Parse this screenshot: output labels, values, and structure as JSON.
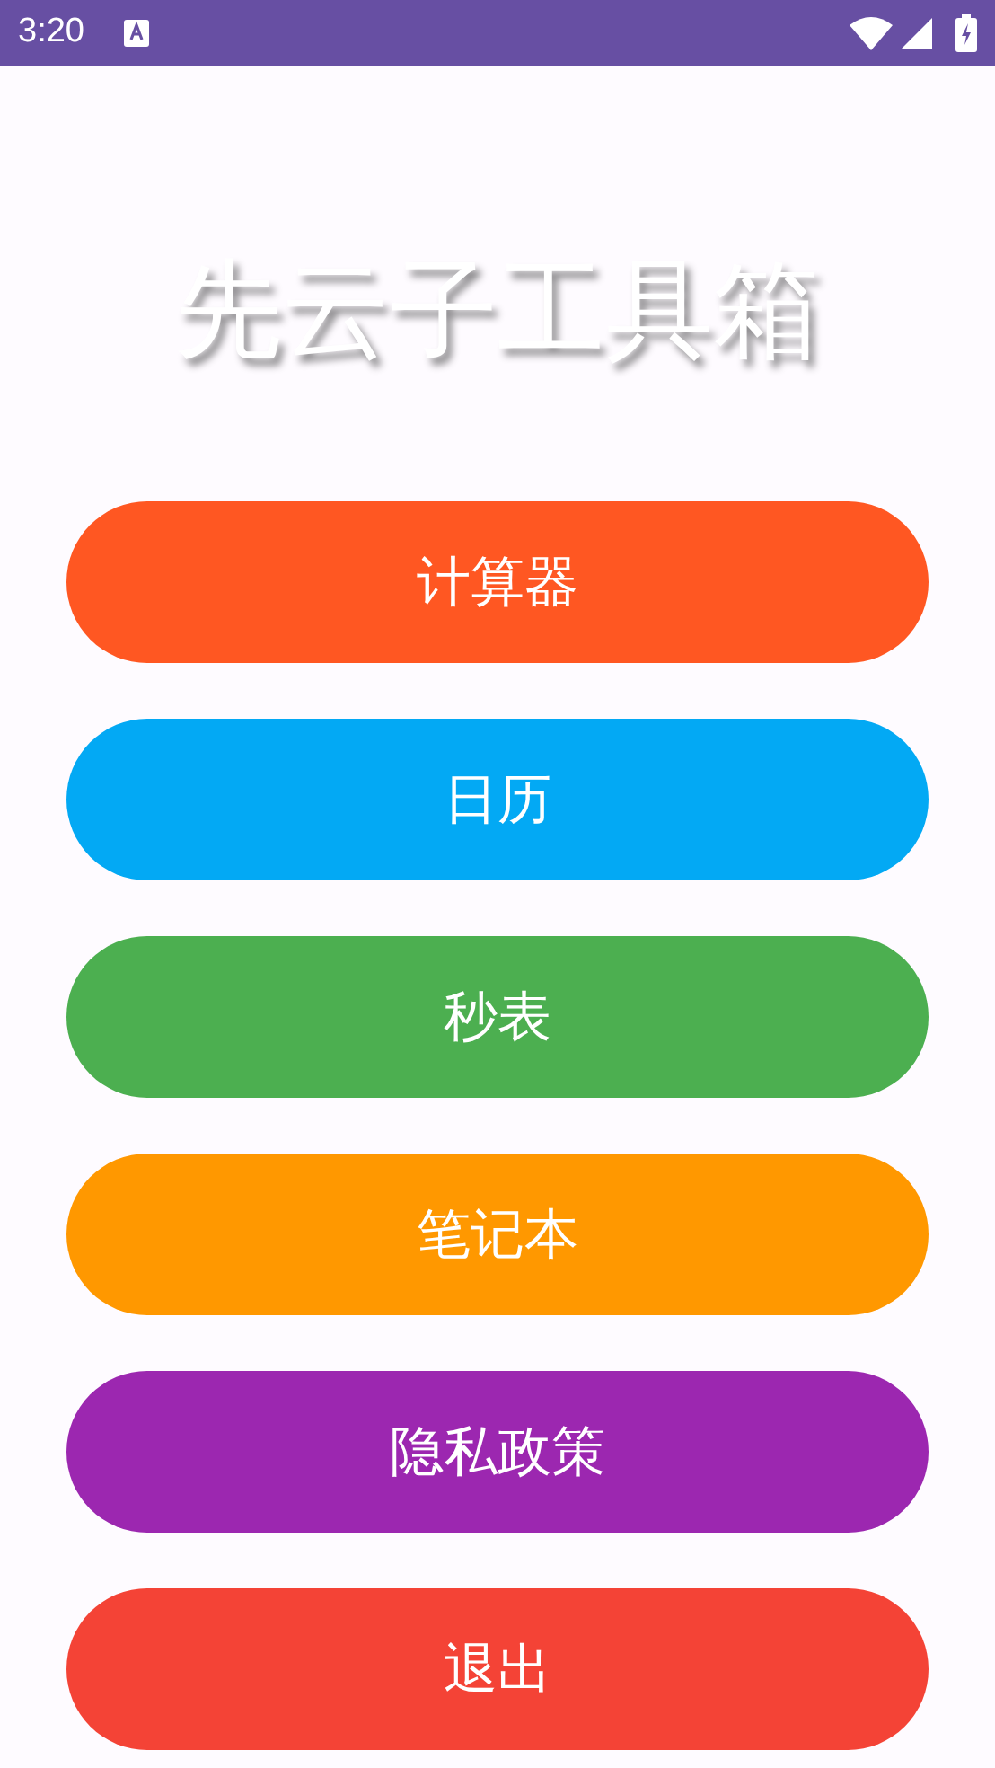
{
  "status_bar": {
    "time": "3:20"
  },
  "title": "先云子工具箱",
  "buttons": [
    {
      "label": "计算器",
      "color": "#ff5722"
    },
    {
      "label": "日历",
      "color": "#03a9f4"
    },
    {
      "label": "秒表",
      "color": "#4caf50"
    },
    {
      "label": "笔记本",
      "color": "#ff9800"
    },
    {
      "label": "隐私政策",
      "color": "#9c27b0"
    },
    {
      "label": "退出",
      "color": "#f44336"
    }
  ]
}
